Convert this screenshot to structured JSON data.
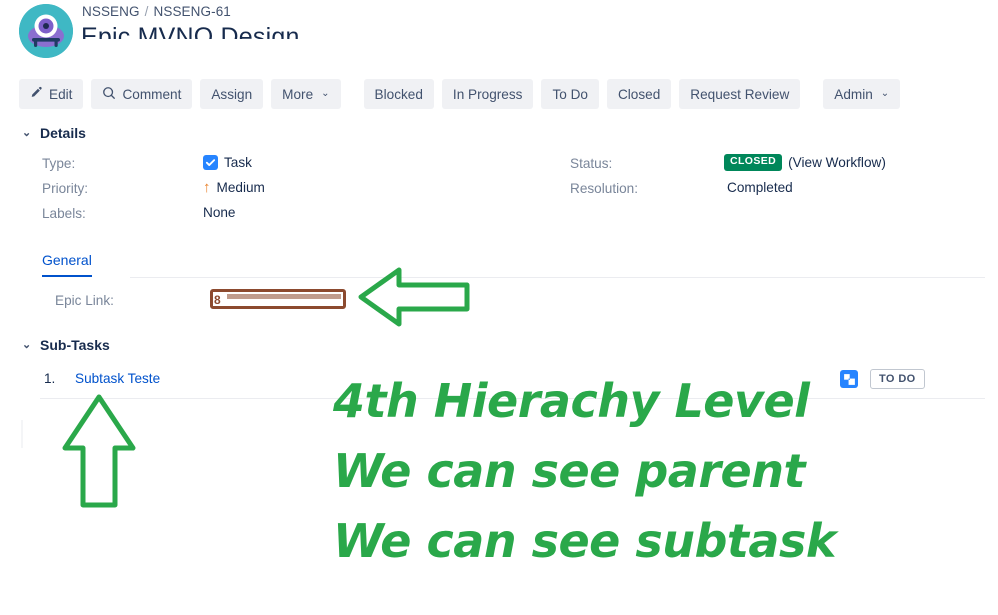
{
  "header": {
    "avatar_icon": "project-avatar-alien-icon",
    "breadcrumb": {
      "project": "NSSENG",
      "separator": "/",
      "issue_key": "NSSENG-61"
    },
    "issue_title": "Epic MVNO Design"
  },
  "toolbar": {
    "buttons": [
      {
        "label": "Edit",
        "icon": "pencil-icon",
        "has_chevron": false
      },
      {
        "label": "Comment",
        "icon": "comment-icon",
        "has_chevron": false
      },
      {
        "label": "Assign",
        "icon": "",
        "has_chevron": false
      },
      {
        "label": "More",
        "icon": "",
        "has_chevron": true
      },
      {
        "label": "Blocked",
        "icon": "",
        "has_chevron": false
      },
      {
        "label": "In Progress",
        "icon": "",
        "has_chevron": false
      },
      {
        "label": "To Do",
        "icon": "",
        "has_chevron": false
      },
      {
        "label": "Closed",
        "icon": "",
        "has_chevron": false
      },
      {
        "label": "Request Review",
        "icon": "",
        "has_chevron": false
      },
      {
        "label": "Admin",
        "icon": "",
        "has_chevron": true
      }
    ],
    "chevron_glyph": "⌄"
  },
  "details": {
    "section_title": "Details",
    "twisty_glyph": "⌄",
    "left_fields": [
      {
        "label": "Type:",
        "value": "Task",
        "icon": "task-checkbox-icon"
      },
      {
        "label": "Priority:",
        "value": "Medium",
        "icon": "priority-medium-up-arrow-icon"
      },
      {
        "label": "Labels:",
        "value": "None",
        "icon": ""
      }
    ],
    "right_fields": [
      {
        "label": "Status:",
        "value": "CLOSED",
        "link": "(View Workflow)"
      },
      {
        "label": "Resolution:",
        "value": "Completed",
        "link": ""
      }
    ],
    "status_color": "#00875a"
  },
  "general_tab": {
    "tab_label": "General",
    "epic_link_label": "Epic Link:",
    "epic_link_value": "8",
    "redaction_color": "#8c4a2f"
  },
  "subtasks": {
    "section_title": "Sub-Tasks",
    "twisty_glyph": "⌄",
    "rows": [
      {
        "number": "1.",
        "title": "Subtask Teste",
        "icon": "subtask-icon",
        "status": "TO DO"
      }
    ]
  },
  "annotations": {
    "color": "#2aa84a",
    "lines": [
      "4th Hierachy Level",
      "We can see parent",
      "We can see subtask"
    ],
    "arrows": [
      {
        "name": "left-arrow-to-epic-link",
        "direction": "left"
      },
      {
        "name": "up-arrow-to-subtask",
        "direction": "up"
      }
    ]
  }
}
